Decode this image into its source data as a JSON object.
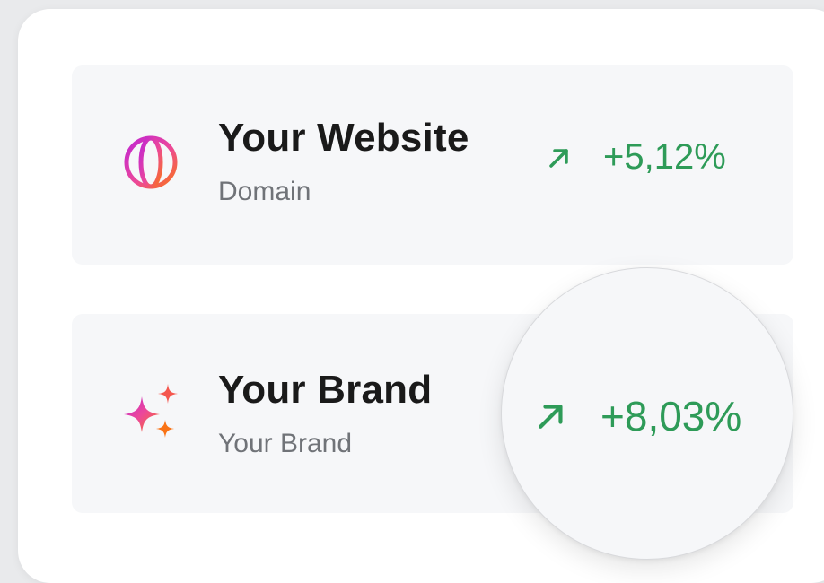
{
  "items": [
    {
      "title": "Your Website",
      "subtitle": "Domain",
      "change": "+5,12%",
      "icon": "globe-icon"
    },
    {
      "title": "Your Brand",
      "subtitle": "Your Brand",
      "change": "+8,03%",
      "icon": "sparkles-icon"
    }
  ],
  "colors": {
    "positive": "#2e9b58",
    "card_bg": "#f6f7f9",
    "title": "#1a1a1a",
    "subtitle": "#707378",
    "gradient_start": "#c026d3",
    "gradient_end": "#f97316"
  }
}
